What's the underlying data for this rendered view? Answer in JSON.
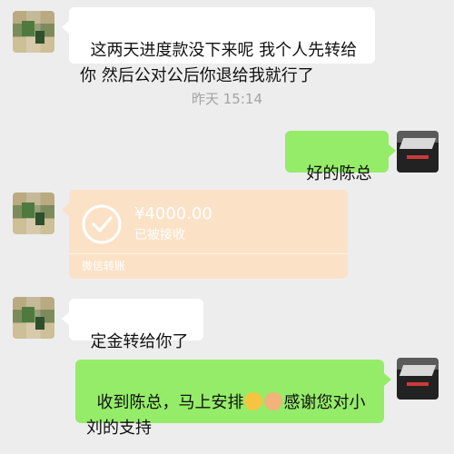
{
  "messages": {
    "first": {
      "text": "这两天进度款没下来呢 我个人先转给你 然后公对公后你退给我就行了"
    },
    "timestamp": "昨天 15:14",
    "reply": {
      "text": "好的陈总"
    },
    "transfer": {
      "amount": "¥4000.00",
      "status": "已被接收",
      "footer": "微信转账"
    },
    "third": {
      "text": "定金转给你了"
    },
    "final": {
      "text_before": "收到陈总，马上安排",
      "text_after": "感谢您对小刘的支持",
      "emoji_1": "smile-emoji",
      "emoji_2": "handshake-emoji"
    }
  }
}
